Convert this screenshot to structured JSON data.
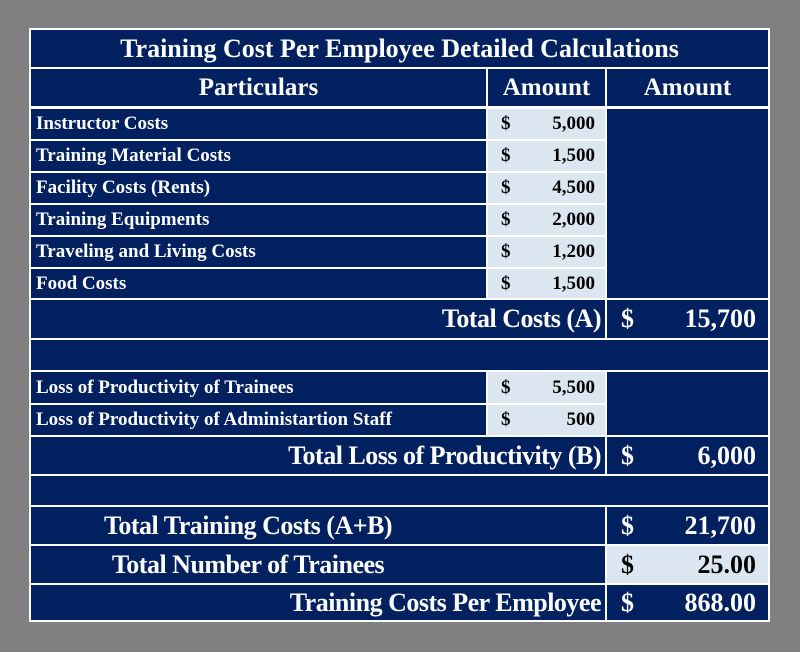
{
  "title": "Training Cost Per Employee Detailed Calculations",
  "headers": {
    "particulars": "Particulars",
    "amount1": "Amount",
    "amount2": "Amount"
  },
  "currency": "$",
  "cost_items": [
    {
      "label": "Instructor Costs",
      "amount": "5,000"
    },
    {
      "label": "Training Material Costs",
      "amount": "1,500"
    },
    {
      "label": "Facility Costs (Rents)",
      "amount": "4,500"
    },
    {
      "label": "Training Equipments",
      "amount": "2,000"
    },
    {
      "label": "Traveling and Living Costs",
      "amount": "1,200"
    },
    {
      "label": "Food Costs",
      "amount": "1,500"
    }
  ],
  "total_costs": {
    "label": "Total Costs (A)",
    "amount": "15,700"
  },
  "productivity_items": [
    {
      "label": "Loss of Productivity of Trainees",
      "amount": "5,500"
    },
    {
      "label": "Loss of Productivity of Administartion Staff",
      "amount": "500"
    }
  ],
  "total_loss": {
    "label": "Total Loss of Productivity (B)",
    "amount": "6,000"
  },
  "summary": [
    {
      "label": "Total Training Costs (A+B)",
      "amount": "21,700"
    },
    {
      "label": "Total Number of Trainees",
      "amount": "25.00"
    },
    {
      "label": "Training Costs Per Employee",
      "amount": "868.00"
    }
  ],
  "colors": {
    "header_bg": "#002060",
    "input_bg": "#dce6f1",
    "page_bg": "#808080"
  }
}
